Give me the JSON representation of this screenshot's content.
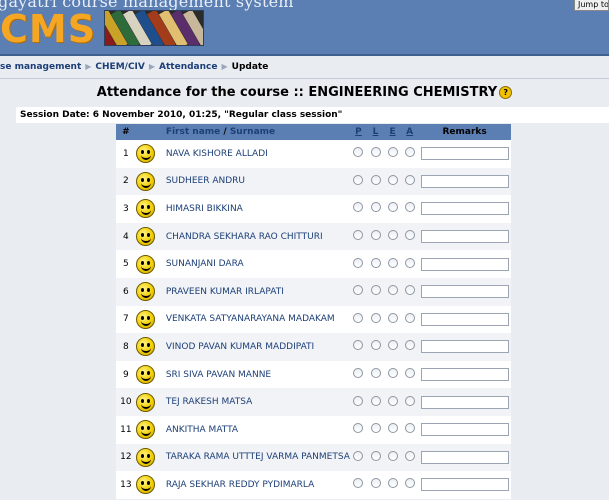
{
  "header": {
    "system_name": "gayatri course management system",
    "logo_text": "CMS",
    "jump_to_label": "Jump to"
  },
  "breadcrumb": {
    "items": [
      "se management",
      "CHEM/CIV",
      "Attendance"
    ],
    "current": "Update",
    "separator": "▶"
  },
  "page": {
    "title": "Attendance for the course :: ENGINEERING CHEMISTRY",
    "help_glyph": "?",
    "session_text": "Session Date: 6 November 2010, 01:25, \"Regular class session\""
  },
  "table": {
    "col_num": "#",
    "col_first": "First name",
    "col_slash": " / ",
    "col_surname": "Surname",
    "col_p": "P",
    "col_l": "L",
    "col_e": "E",
    "col_a": "A",
    "col_remarks": "Remarks",
    "rows": [
      {
        "num": "1",
        "name": "NAVA KISHORE ALLADI"
      },
      {
        "num": "2",
        "name": "SUDHEER ANDRU"
      },
      {
        "num": "3",
        "name": "HIMASRI BIKKINA"
      },
      {
        "num": "4",
        "name": "CHANDRA SEKHARA RAO CHITTURI"
      },
      {
        "num": "5",
        "name": "SUNANJANI DARA"
      },
      {
        "num": "6",
        "name": "PRAVEEN KUMAR IRLAPATI"
      },
      {
        "num": "7",
        "name": "VENKATA SATYANARAYANA MADAKAM"
      },
      {
        "num": "8",
        "name": "VINOD PAVAN KUMAR MADDIPATI"
      },
      {
        "num": "9",
        "name": "SRI SIVA PAVAN MANNE"
      },
      {
        "num": "10",
        "name": "TEJ RAKESH MATSA"
      },
      {
        "num": "11",
        "name": "ANKITHA MATTA"
      },
      {
        "num": "12",
        "name": "TARAKA RAMA UTTTEJ VARMA PANMETSA"
      },
      {
        "num": "13",
        "name": "RAJA SEKHAR REDDY PYDIMARLA"
      }
    ]
  },
  "colors": {
    "banner": "#5c7fb3",
    "link": "#1c3f77",
    "logo": "#f5a623"
  }
}
